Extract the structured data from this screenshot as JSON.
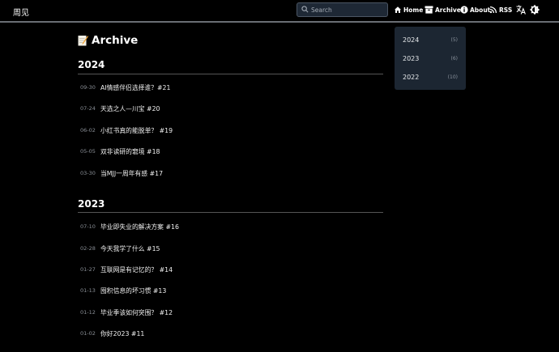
{
  "nav": {
    "brand": "周见",
    "search_placeholder": "Search",
    "items": [
      {
        "label": "Home",
        "icon": "home-icon"
      },
      {
        "label": "Archive",
        "icon": "archive-box-icon"
      },
      {
        "label": "About",
        "icon": "info-circle-icon"
      },
      {
        "label": "RSS",
        "icon": "rss-feed-icon"
      }
    ],
    "extra_icons": [
      "translate-icon",
      "theme-toggle-icon"
    ]
  },
  "page": {
    "title_emoji": "memo-icon",
    "title": "Archive"
  },
  "archive": [
    {
      "year": "2024",
      "posts": [
        {
          "date": "09-30",
          "title": "AI情感伴侣选择谁？#21"
        },
        {
          "date": "07-24",
          "title": "天选之人—川宝 #20"
        },
        {
          "date": "06-02",
          "title": "小红书真的能脱单？ #19"
        },
        {
          "date": "05-05",
          "title": "双非读研的窘境 #18"
        },
        {
          "date": "03-30",
          "title": "当MJJ一周年有感 #17"
        }
      ]
    },
    {
      "year": "2023",
      "posts": [
        {
          "date": "07-10",
          "title": "毕业即失业的解决方案 #16"
        },
        {
          "date": "02-28",
          "title": "今天我学了什么 #15"
        },
        {
          "date": "01-27",
          "title": "互联网是有记忆的？ #14"
        },
        {
          "date": "01-13",
          "title": "囤积信息的坏习惯 #13"
        },
        {
          "date": "01-12",
          "title": "毕业季该如何突围？ #12"
        },
        {
          "date": "01-02",
          "title": "你好2023 #11"
        }
      ]
    }
  ],
  "dropdown": {
    "items": [
      {
        "year": "2024",
        "count": "(5)"
      },
      {
        "year": "2023",
        "count": "(6)"
      },
      {
        "year": "2022",
        "count": "(10)"
      }
    ]
  },
  "colors": {
    "background": "#000000",
    "dropdown_bg": "#1c2632",
    "search_bg": "#1e2835"
  }
}
